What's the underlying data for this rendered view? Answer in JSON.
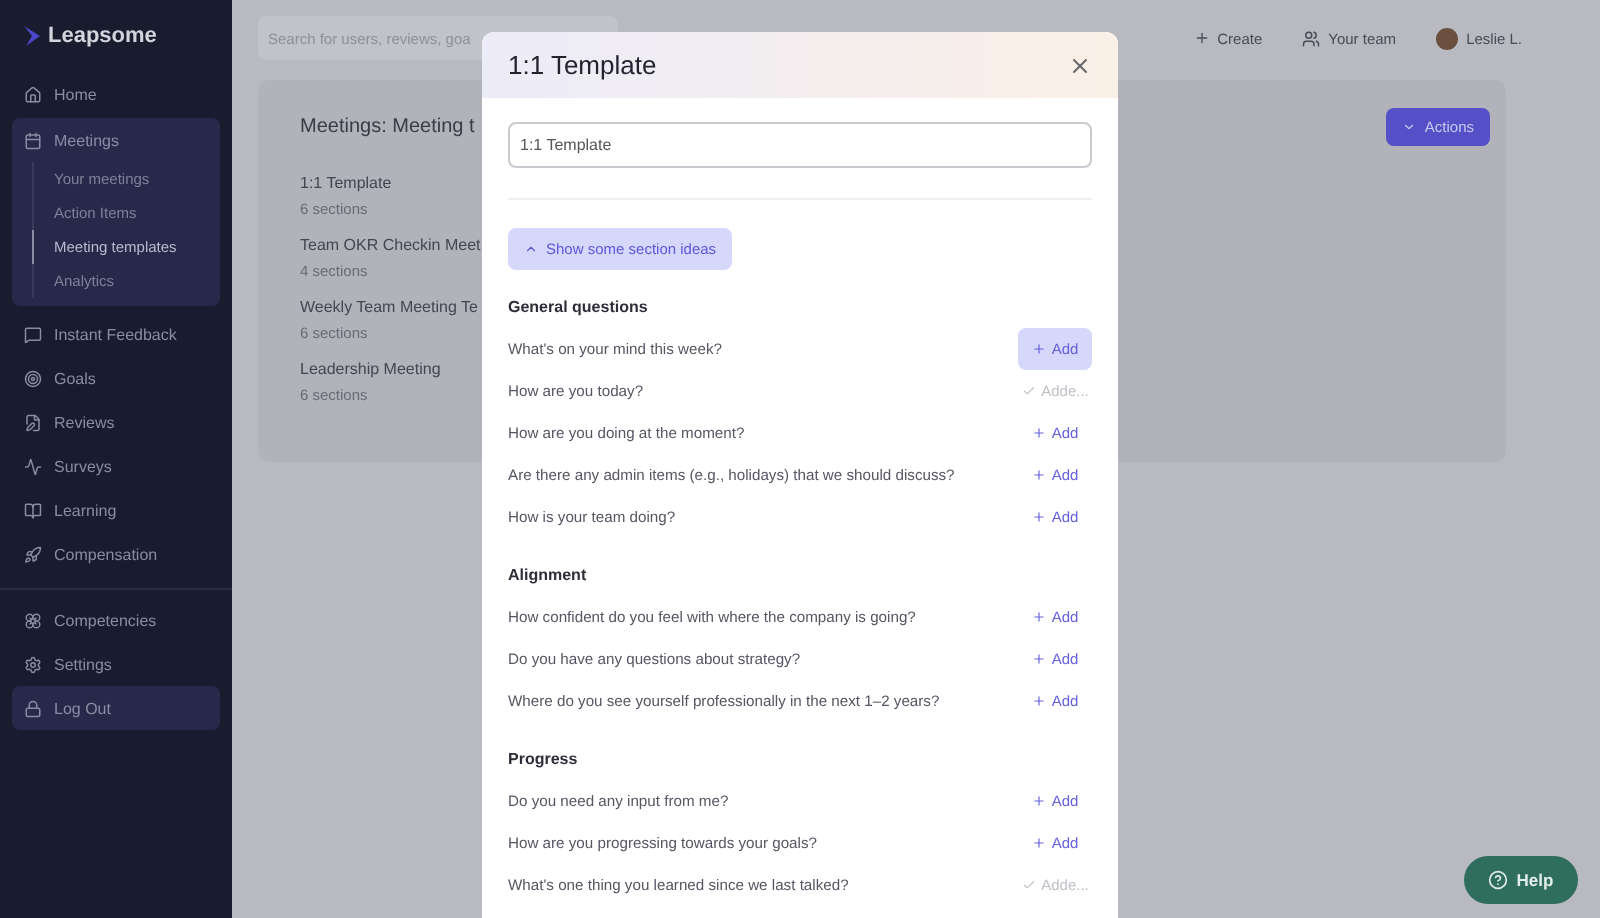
{
  "brand": "Leapsome",
  "sidebar": {
    "items": [
      {
        "label": "Home",
        "selected": false
      },
      {
        "label": "Meetings",
        "selected": true,
        "children": [
          {
            "label": "Your meetings",
            "selected": false
          },
          {
            "label": "Action Items",
            "selected": false
          },
          {
            "label": "Meeting templates",
            "selected": true
          },
          {
            "label": "Analytics",
            "selected": false
          }
        ]
      },
      {
        "label": "Instant Feedback",
        "selected": false
      },
      {
        "label": "Goals",
        "selected": false
      },
      {
        "label": "Reviews",
        "selected": false
      },
      {
        "label": "Surveys",
        "selected": false
      },
      {
        "label": "Learning",
        "selected": false
      },
      {
        "label": "Compensation",
        "selected": false
      }
    ],
    "bottom_items": [
      {
        "label": "Competencies",
        "selected": false
      },
      {
        "label": "Settings",
        "selected": false
      },
      {
        "label": "Log Out",
        "selected": true
      }
    ]
  },
  "search": {
    "placeholder": "Search for users, reviews, goa"
  },
  "topbar": {
    "create": "Create",
    "team": "Your team",
    "user": "Leslie L."
  },
  "page": {
    "title": "Meetings: Meeting t",
    "actions": "Actions",
    "templates": [
      {
        "name": "1:1 Template",
        "sections": "6 sections"
      },
      {
        "name": "Team OKR Checkin Meet",
        "sections": "4 sections"
      },
      {
        "name": "Weekly Team Meeting Te",
        "sections": "6 sections"
      },
      {
        "name": "Leadership Meeting",
        "sections": "6 sections"
      }
    ]
  },
  "modal": {
    "title": "1:1 Template",
    "name_value": "1:1 Template",
    "ideas_button": "Show some section ideas",
    "groups": [
      {
        "heading": "General questions",
        "questions": [
          {
            "text": "What's on your mind this week?",
            "action": "Add",
            "added": false,
            "highlighted": true
          },
          {
            "text": "How are you today?",
            "action": "Adde...",
            "added": true,
            "highlighted": false
          },
          {
            "text": "How are you doing at the moment?",
            "action": "Add",
            "added": false,
            "highlighted": false
          },
          {
            "text": "Are there any admin items (e.g., holidays) that we should discuss?",
            "action": "Add",
            "added": false,
            "highlighted": false
          },
          {
            "text": "How is your team doing?",
            "action": "Add",
            "added": false,
            "highlighted": false
          }
        ]
      },
      {
        "heading": "Alignment",
        "questions": [
          {
            "text": "How confident do you feel with where the company is going?",
            "action": "Add",
            "added": false,
            "highlighted": false
          },
          {
            "text": "Do you have any questions about strategy?",
            "action": "Add",
            "added": false,
            "highlighted": false
          },
          {
            "text": "Where do you see yourself professionally in the next 1–2 years?",
            "action": "Add",
            "added": false,
            "highlighted": false
          }
        ]
      },
      {
        "heading": "Progress",
        "questions": [
          {
            "text": "Do you need any input from me?",
            "action": "Add",
            "added": false,
            "highlighted": false
          },
          {
            "text": "How are you progressing towards your goals?",
            "action": "Add",
            "added": false,
            "highlighted": false
          },
          {
            "text": "What's one thing you learned since we last talked?",
            "action": "Adde...",
            "added": true,
            "highlighted": false
          }
        ]
      }
    ]
  },
  "help": "Help"
}
